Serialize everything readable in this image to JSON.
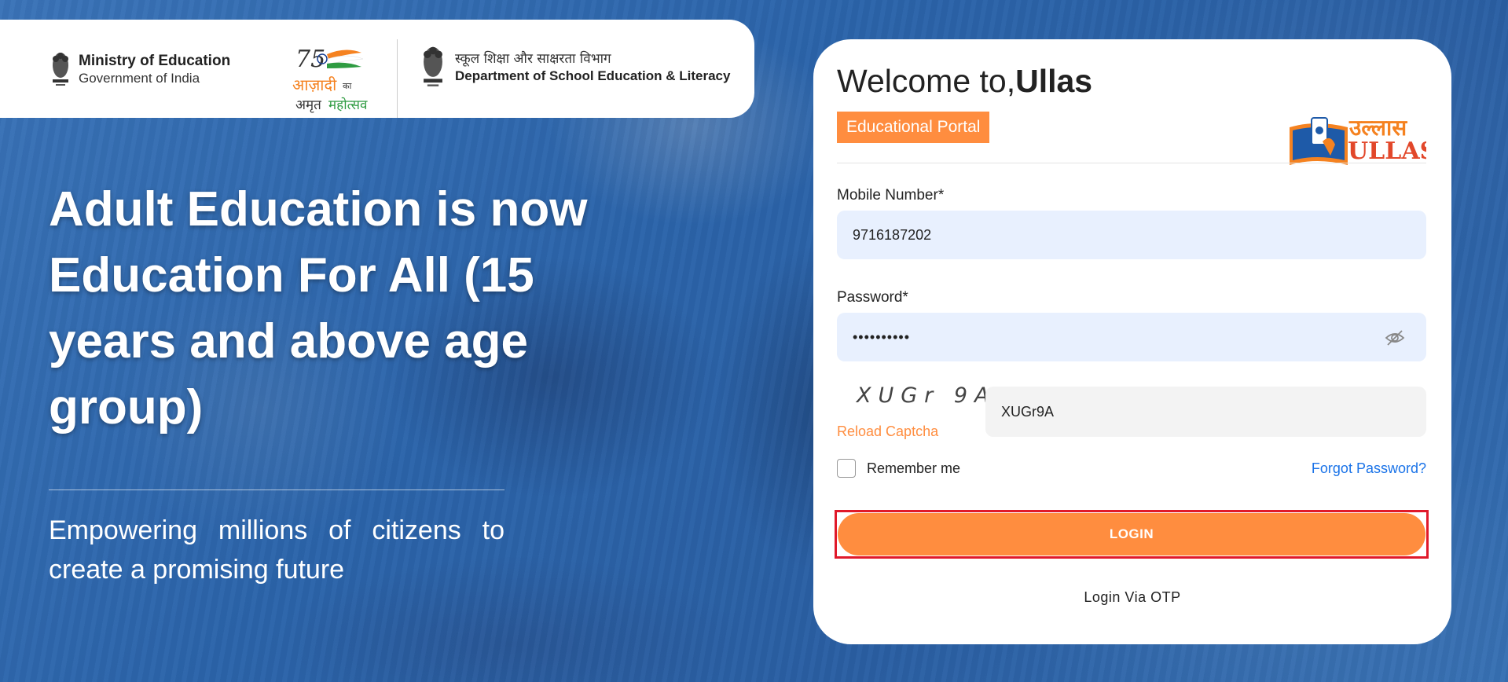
{
  "header": {
    "ministry_title": "Ministry of Education",
    "ministry_sub": "Government of India",
    "azadi_hindi": "आज़ादी का अमृत महोत्सव",
    "dept_hindi": "स्कूल शिक्षा और साक्षरता विभाग",
    "dept_english": "Department of School Education & Literacy"
  },
  "hero": {
    "title": "Adult Education is now Education For All (15 years and above age group)",
    "subtitle": "Empowering millions of citizens to create a promising future"
  },
  "login": {
    "welcome_prefix": "Welcome to,",
    "welcome_brand": "Ullas",
    "portal_badge": "Educational Portal",
    "logo_hindi": "उल्लास",
    "logo_english": "ULLAS",
    "mobile_label": "Mobile Number*",
    "mobile_value": "9716187202",
    "password_label": "Password*",
    "password_value": "••••••••••",
    "captcha_text": "XUGr 9A",
    "reload_captcha": "Reload Captcha",
    "captcha_value": "XUGr9A",
    "remember_me": "Remember me",
    "forgot_password": "Forgot Password?",
    "login_button": "LOGIN",
    "login_otp": "Login Via OTP"
  },
  "colors": {
    "accent": "#ff8d3f",
    "link": "#1a73e8",
    "highlight": "#e0192a",
    "input_bg": "#e8f0fe"
  }
}
